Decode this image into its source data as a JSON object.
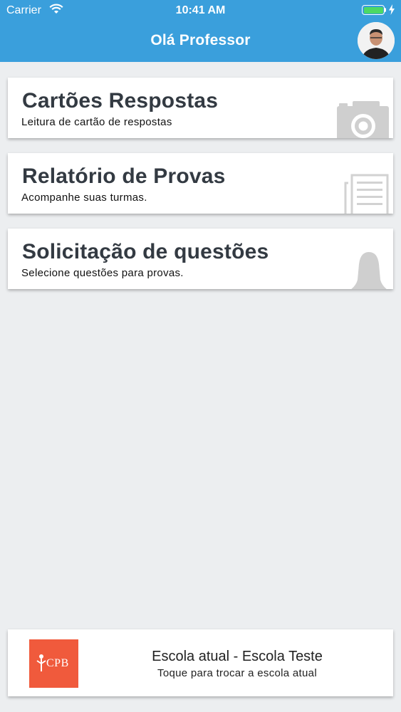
{
  "status_bar": {
    "carrier": "Carrier",
    "time": "10:41 AM",
    "battery_color": "#4cd964"
  },
  "header": {
    "title": "Olá Professor",
    "background": "#3a9fdc"
  },
  "cards": [
    {
      "title": "Cartões Respostas",
      "subtitle": "Leitura de cartão de respostas",
      "icon": "camera-icon"
    },
    {
      "title": "Relatório de Provas",
      "subtitle": "Acompanhe suas turmas.",
      "icon": "document-icon"
    },
    {
      "title": "Solicitação de questões",
      "subtitle": "Selecione questões para provas.",
      "icon": "bell-icon"
    }
  ],
  "footer": {
    "logo_text": "CPB",
    "logo_color": "#f05a3c",
    "school_label": "Escola atual - Escola Teste",
    "hint": "Toque para trocar a escola atual"
  }
}
